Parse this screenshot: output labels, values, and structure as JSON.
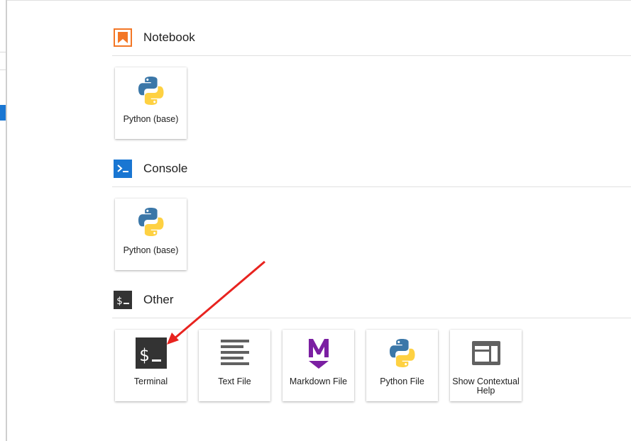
{
  "sections": {
    "notebook": {
      "title": "Notebook",
      "icon": "notebook-bookmark-icon",
      "items": [
        {
          "label": "Python (base)",
          "icon": "python-logo-icon"
        }
      ]
    },
    "console": {
      "title": "Console",
      "icon": "console-prompt-icon",
      "items": [
        {
          "label": "Python (base)",
          "icon": "python-logo-icon"
        }
      ]
    },
    "other": {
      "title": "Other",
      "icon": "terminal-dollar-icon",
      "items": [
        {
          "label": "Terminal",
          "icon": "terminal-icon"
        },
        {
          "label": "Text File",
          "icon": "text-file-icon"
        },
        {
          "label": "Markdown File",
          "icon": "markdown-icon"
        },
        {
          "label": "Python File",
          "icon": "python-logo-icon"
        },
        {
          "label": "Show Contextual Help",
          "icon": "contextual-help-icon"
        }
      ]
    }
  },
  "colors": {
    "notebook_accent": "#f37726",
    "console_accent": "#1976d2",
    "other_accent": "#333333",
    "markdown_purple": "#7b1fa2",
    "annotation_arrow": "#e8231f",
    "python_blue": "#3b77a8",
    "python_yellow": "#fed142"
  }
}
